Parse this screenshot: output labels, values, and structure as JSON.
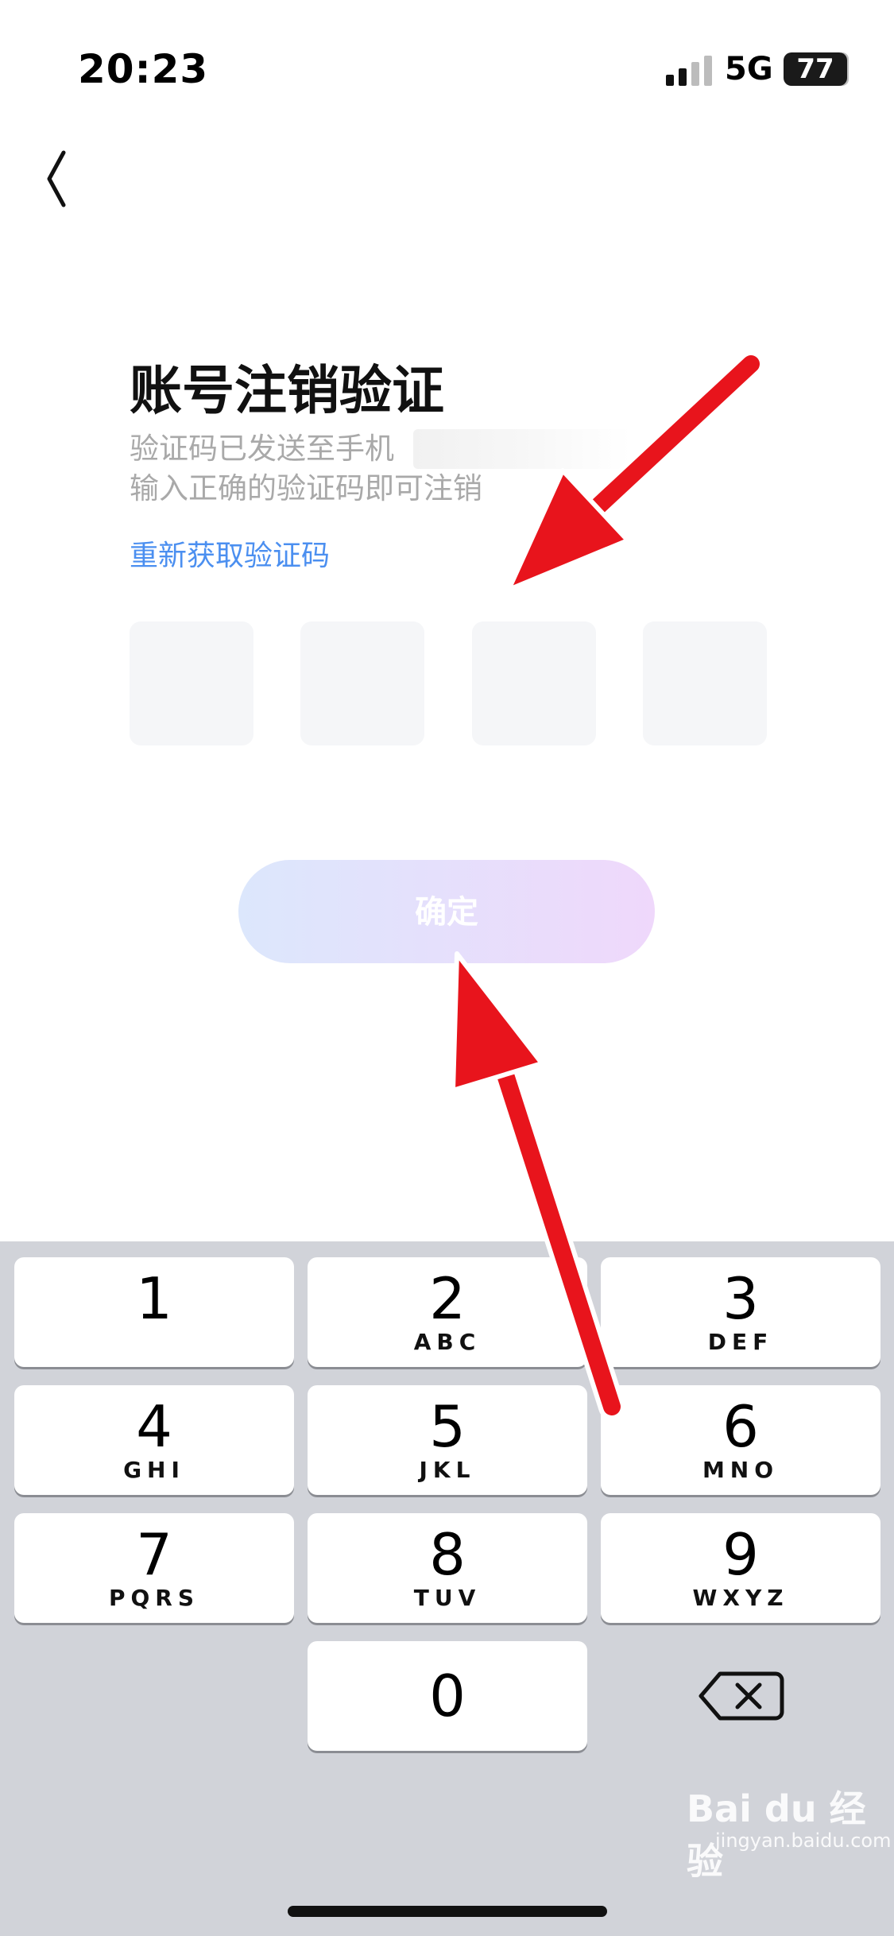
{
  "status_bar": {
    "time": "20:23",
    "network": "5G",
    "battery": "77"
  },
  "page": {
    "title": "账号注销验证",
    "desc_line1": "验证码已发送至手机",
    "desc_line2": "输入正确的验证码即可注销",
    "resend_label": "重新获取验证码",
    "confirm_label": "确定"
  },
  "keyboard": {
    "keys": [
      {
        "num": "1",
        "letters": ""
      },
      {
        "num": "2",
        "letters": "ABC"
      },
      {
        "num": "3",
        "letters": "DEF"
      },
      {
        "num": "4",
        "letters": "GHI"
      },
      {
        "num": "5",
        "letters": "JKL"
      },
      {
        "num": "6",
        "letters": "MNO"
      },
      {
        "num": "7",
        "letters": "PQRS"
      },
      {
        "num": "8",
        "letters": "TUV"
      },
      {
        "num": "9",
        "letters": "WXYZ"
      },
      {
        "num": "0",
        "letters": ""
      }
    ]
  },
  "watermark": {
    "brand": "Bai du 经验",
    "site": "jingyan.baidu.com"
  },
  "colors": {
    "accent": "#4b8ff0",
    "arrow": "#e8141c",
    "button_gradient_start": "#dce7fc",
    "button_gradient_end": "#efd8fb"
  }
}
